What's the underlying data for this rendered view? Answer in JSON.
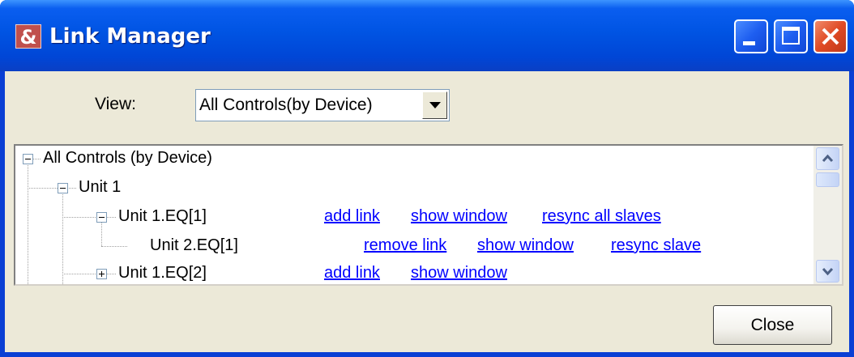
{
  "window": {
    "title": "Link Manager",
    "app_icon_glyph": "&",
    "controls": [
      "minimize-icon",
      "maximize-icon",
      "close-icon"
    ]
  },
  "view": {
    "label": "View:",
    "selected": "All Controls(by Device)"
  },
  "tree": {
    "root": {
      "label": "All Controls (by Device)",
      "state": "expanded"
    },
    "unit1": {
      "label": "Unit 1",
      "state": "expanded"
    },
    "eq1": {
      "label": "Unit 1.EQ[1]",
      "state": "expanded",
      "links": [
        "add link",
        "show window",
        "resync all slaves"
      ]
    },
    "eq1_slave": {
      "label": "Unit 2.EQ[1]",
      "links": [
        "remove link",
        "show window",
        "resync slave"
      ]
    },
    "eq2": {
      "label": "Unit 1.EQ[2]",
      "state": "collapsed",
      "links": [
        "add link",
        "show window"
      ]
    }
  },
  "footer": {
    "close_label": "Close"
  },
  "colors": {
    "titlebar": "#0054e3",
    "client": "#ece9d8",
    "link": "#0000ff"
  }
}
